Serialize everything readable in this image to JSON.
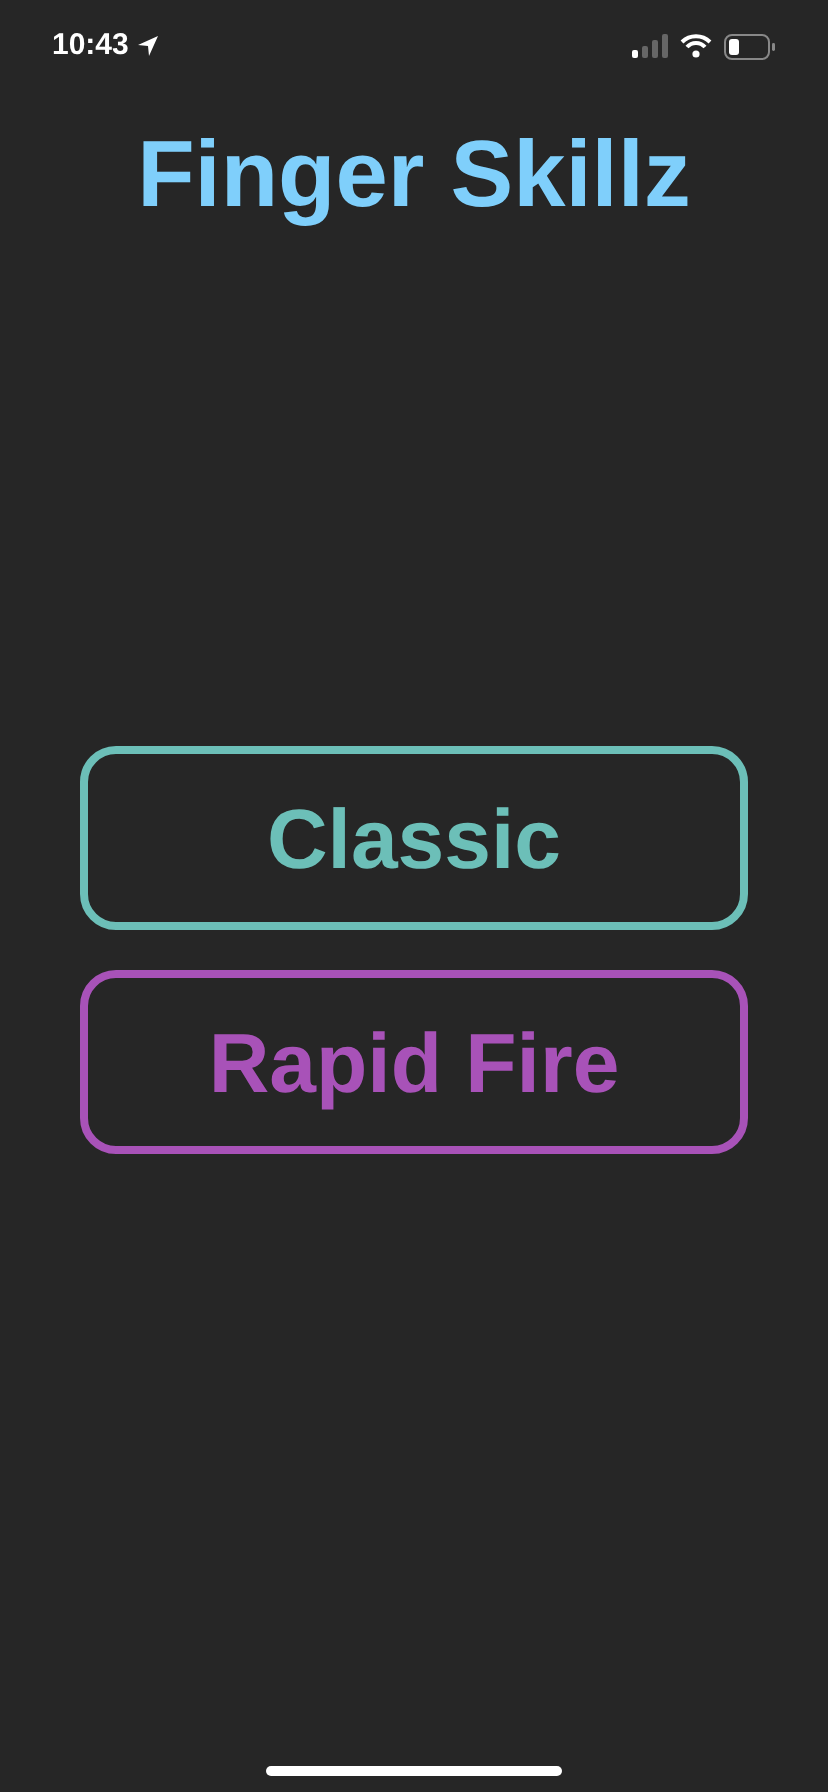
{
  "status_bar": {
    "time": "10:43"
  },
  "title": "Finger Skillz",
  "modes": [
    {
      "label": "Classic",
      "color": "#6cbfb8"
    },
    {
      "label": "Rapid Fire",
      "color": "#a852b8"
    }
  ]
}
